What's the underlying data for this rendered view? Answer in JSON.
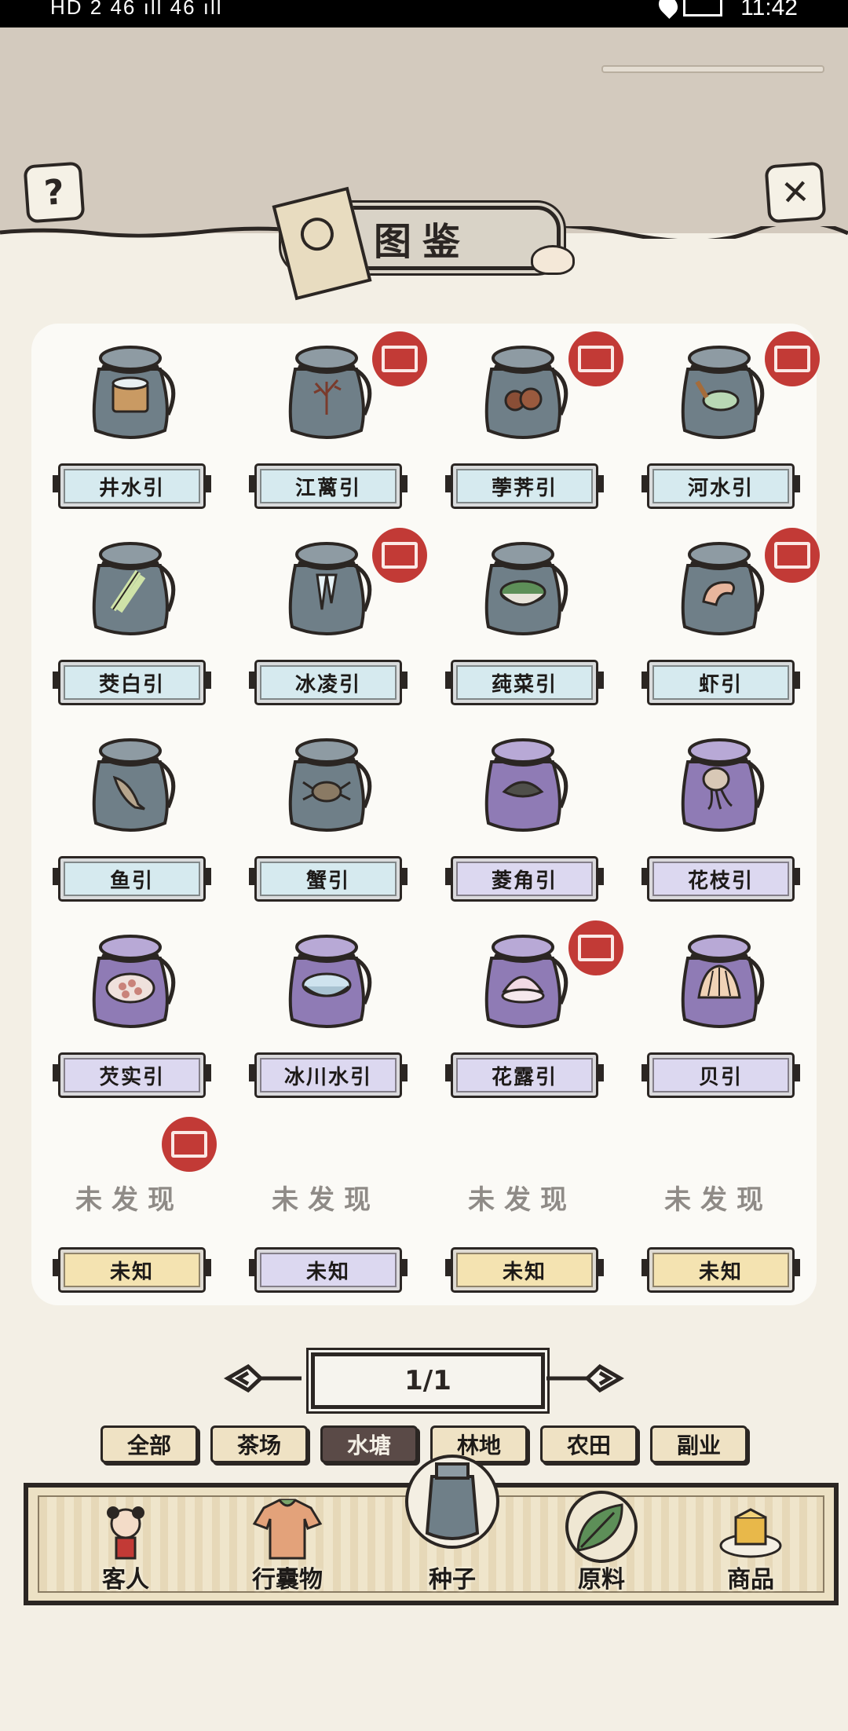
{
  "status_bar": {
    "left": "HD 2 46 ıll 46 ıll",
    "time": "11:42"
  },
  "header": {
    "title": "图鉴",
    "help_icon": "question-icon",
    "close_icon": "close-icon"
  },
  "grid": [
    {
      "name": "井水引",
      "jar": "grey",
      "plate": "blue",
      "seal": false,
      "content": "bucket"
    },
    {
      "name": "江蓠引",
      "jar": "grey",
      "plate": "blue",
      "seal": true,
      "content": "seaweed"
    },
    {
      "name": "荸荠引",
      "jar": "grey",
      "plate": "blue",
      "seal": true,
      "content": "chestnut"
    },
    {
      "name": "河水引",
      "jar": "grey",
      "plate": "blue",
      "seal": true,
      "content": "ladle"
    },
    {
      "name": "茭白引",
      "jar": "grey",
      "plate": "blue",
      "seal": false,
      "content": "stalk"
    },
    {
      "name": "冰凌引",
      "jar": "grey",
      "plate": "blue",
      "seal": true,
      "content": "icicle"
    },
    {
      "name": "莼菜引",
      "jar": "grey",
      "plate": "blue",
      "seal": false,
      "content": "bowl"
    },
    {
      "name": "虾引",
      "jar": "grey",
      "plate": "blue",
      "seal": true,
      "content": "shrimp"
    },
    {
      "name": "鱼引",
      "jar": "grey",
      "plate": "blue",
      "seal": false,
      "content": "fish"
    },
    {
      "name": "蟹引",
      "jar": "grey",
      "plate": "blue",
      "seal": false,
      "content": "crab"
    },
    {
      "name": "菱角引",
      "jar": "purple",
      "plate": "purple",
      "seal": false,
      "content": "caltrop"
    },
    {
      "name": "花枝引",
      "jar": "purple",
      "plate": "purple",
      "seal": false,
      "content": "squid"
    },
    {
      "name": "芡实引",
      "jar": "purple",
      "plate": "purple",
      "seal": false,
      "content": "seeds"
    },
    {
      "name": "冰川水引",
      "jar": "purple",
      "plate": "purple",
      "seal": false,
      "content": "ice-bowl"
    },
    {
      "name": "花露引",
      "jar": "purple",
      "plate": "purple",
      "seal": true,
      "content": "shell-open"
    },
    {
      "name": "贝引",
      "jar": "purple",
      "plate": "purple",
      "seal": false,
      "content": "scallop"
    }
  ],
  "undiscovered": [
    {
      "status": "未发现",
      "name": "未知",
      "plate": "yellow",
      "seal": true
    },
    {
      "status": "未发现",
      "name": "未知",
      "plate": "purple",
      "seal": false
    },
    {
      "status": "未发现",
      "name": "未知",
      "plate": "yellow",
      "seal": false
    },
    {
      "status": "未发现",
      "name": "未知",
      "plate": "yellow",
      "seal": false
    }
  ],
  "pagination": {
    "label": "1/1"
  },
  "tabs": [
    {
      "label": "全部",
      "active": false
    },
    {
      "label": "茶场",
      "active": false
    },
    {
      "label": "水塘",
      "active": true
    },
    {
      "label": "林地",
      "active": false
    },
    {
      "label": "农田",
      "active": false
    },
    {
      "label": "副业",
      "active": false
    }
  ],
  "bottom_nav": [
    {
      "label": "客人",
      "icon": "guest-icon"
    },
    {
      "label": "行囊物",
      "icon": "clothes-icon"
    },
    {
      "label": "种子",
      "icon": "seed-bag-icon"
    },
    {
      "label": "原料",
      "icon": "leaf-icon"
    },
    {
      "label": "商品",
      "icon": "goods-icon"
    }
  ],
  "colors": {
    "seal": "#c23a36",
    "grey_jar": "#6f7f88",
    "purple_jar": "#8f7bb5",
    "plate_blue": "#d6eaef",
    "plate_purple": "#dcd8f0",
    "plate_yellow": "#f4e3b1",
    "ink": "#2b2623"
  }
}
